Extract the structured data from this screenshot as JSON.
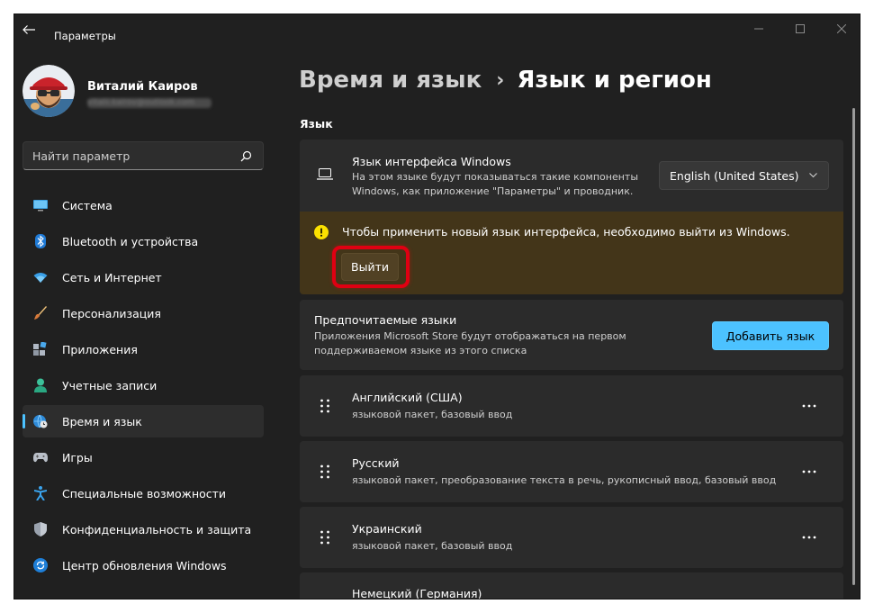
{
  "window": {
    "title": "Параметры"
  },
  "user": {
    "name": "Виталий Каиров",
    "email": "vitalii.kairov@outlook.com"
  },
  "search": {
    "placeholder": "Найти параметр"
  },
  "sidebar": {
    "items": [
      {
        "label": "Система",
        "icon": "monitor-icon"
      },
      {
        "label": "Bluetooth и устройства",
        "icon": "bluetooth-icon"
      },
      {
        "label": "Сеть и Интернет",
        "icon": "wifi-icon"
      },
      {
        "label": "Персонализация",
        "icon": "brush-icon"
      },
      {
        "label": "Приложения",
        "icon": "apps-icon"
      },
      {
        "label": "Учетные записи",
        "icon": "person-icon"
      },
      {
        "label": "Время и язык",
        "icon": "globe-clock-icon",
        "active": true
      },
      {
        "label": "Игры",
        "icon": "gamepad-icon"
      },
      {
        "label": "Специальные возможности",
        "icon": "accessibility-icon"
      },
      {
        "label": "Конфиденциальность и защита",
        "icon": "shield-icon"
      },
      {
        "label": "Центр обновления Windows",
        "icon": "update-icon"
      }
    ]
  },
  "breadcrumb": {
    "parent": "Время и язык",
    "separator": "›",
    "current": "Язык и регион"
  },
  "section": {
    "label": "Язык"
  },
  "display_language": {
    "title": "Язык интерфейса Windows",
    "description": "На этом языке будут показываться такие компоненты Windows, как приложение \"Параметры\" и проводник.",
    "selected": "English (United States)"
  },
  "warning": {
    "text": "Чтобы применить новый язык интерфейса, необходимо выйти из Windows.",
    "button_label": "Выйти"
  },
  "preferred": {
    "title": "Предпочитаемые языки",
    "description": "Приложения Microsoft Store будут отображаться на первом поддерживаемом языке из этого списка",
    "button_label": "Добавить язык"
  },
  "languages": [
    {
      "name": "Английский (США)",
      "features": "языковой пакет, базовый ввод"
    },
    {
      "name": "Русский",
      "features": "языковой пакет, преобразование текста в речь, рукописный ввод, базовый ввод"
    },
    {
      "name": "Украинский",
      "features": "языковой пакет, базовый ввод"
    },
    {
      "name": "Немецкий (Германия)",
      "features": ""
    }
  ],
  "colors": {
    "accent": "#4cc2ff",
    "background": "#202020",
    "card": "#2b2b2b",
    "warning_bg": "#433519",
    "highlight": "#e00012"
  }
}
